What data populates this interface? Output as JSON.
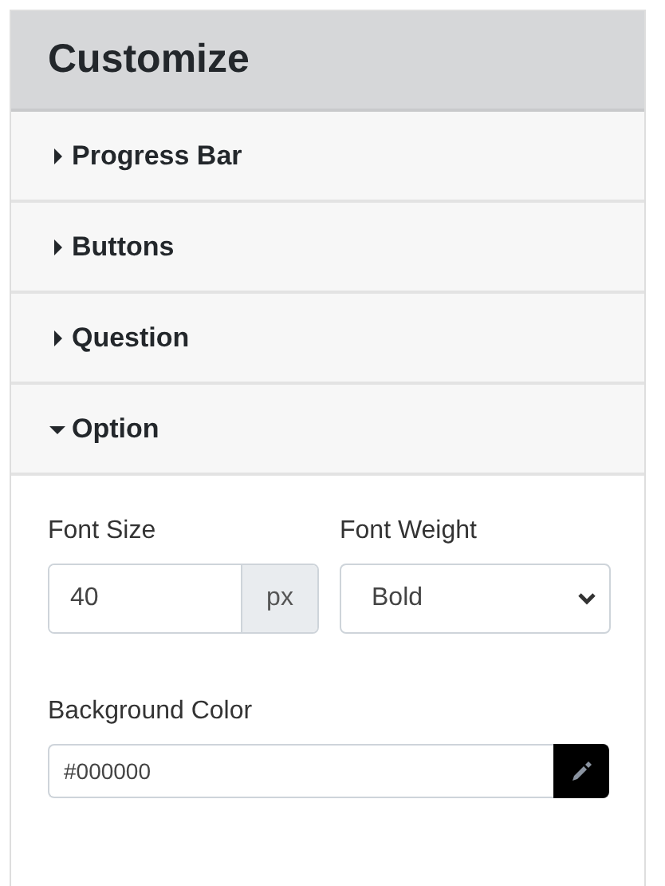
{
  "panel": {
    "title": "Customize"
  },
  "sections": [
    {
      "label": "Progress Bar",
      "expanded": false
    },
    {
      "label": "Buttons",
      "expanded": false
    },
    {
      "label": "Question",
      "expanded": false
    },
    {
      "label": "Option",
      "expanded": true
    }
  ],
  "option_form": {
    "font_size": {
      "label": "Font Size",
      "value": "40",
      "unit": "px"
    },
    "font_weight": {
      "label": "Font Weight",
      "value": "Bold"
    },
    "background_color": {
      "label": "Background Color",
      "value": "#000000"
    }
  }
}
